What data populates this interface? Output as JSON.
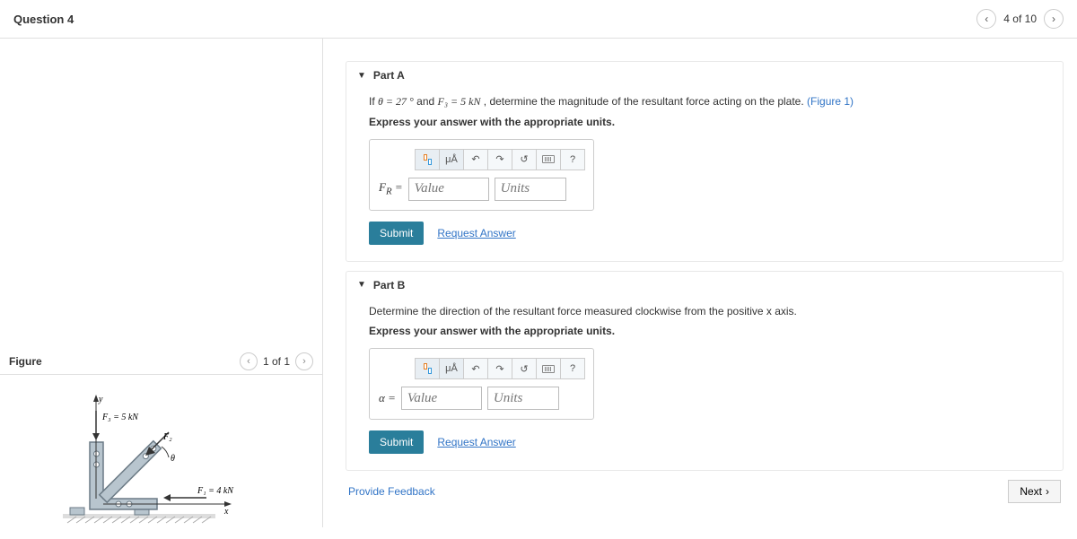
{
  "header": {
    "title": "Question 4",
    "page_indicator": "4 of 10"
  },
  "figure": {
    "title": "Figure",
    "pager": "1 of 1",
    "labels": {
      "y_axis": "y",
      "x_axis": "x",
      "f3": "F₃ = 5 kN",
      "f2": "F₂",
      "f1": "F₁ = 4 kN",
      "theta": "θ"
    }
  },
  "partA": {
    "title": "Part A",
    "prompt_before": "If ",
    "theta_eq": "θ = 27 °",
    "and_text": " and ",
    "f3_eq": "F₃ = 5 kN",
    "prompt_after": " , determine the magnitude of the resultant force acting on the plate.",
    "figure_ref": "(Figure 1)",
    "instruction": "Express your answer with the appropriate units.",
    "var_label": "F_R =",
    "value_placeholder": "Value",
    "units_placeholder": "Units",
    "toolbar": {
      "units_label": "μÅ",
      "help": "?"
    },
    "submit": "Submit",
    "request": "Request Answer"
  },
  "partB": {
    "title": "Part B",
    "prompt": "Determine the direction of the resultant force measured clockwise from the positive x axis.",
    "instruction": "Express your answer with the appropriate units.",
    "var_label": "α =",
    "value_placeholder": "Value",
    "units_placeholder": "Units",
    "toolbar": {
      "units_label": "μÅ",
      "help": "?"
    },
    "submit": "Submit",
    "request": "Request Answer"
  },
  "footer": {
    "feedback": "Provide Feedback",
    "next": "Next"
  }
}
